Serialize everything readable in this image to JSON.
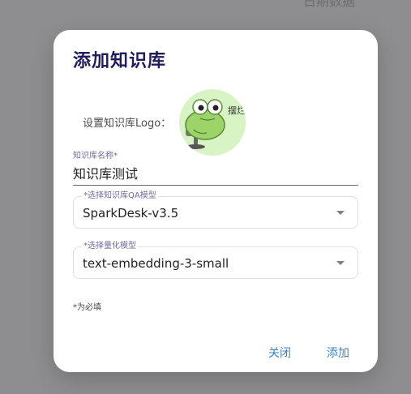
{
  "background": {
    "partial_text": "日期数据"
  },
  "dialog": {
    "title": "添加知识库",
    "logo_label": "设置知识库Logo：",
    "logo_text": "摆烂",
    "name_field": {
      "label": "知识库名称*",
      "value": "知识库测试"
    },
    "qa_model_select": {
      "label": "*选择知识库QA模型",
      "value": "SparkDesk-v3.5"
    },
    "embedding_model_select": {
      "label": "*选择量化模型",
      "value": "text-embedding-3-small"
    },
    "required_note": "*为必填",
    "close_label": "关闭",
    "add_label": "添加"
  },
  "colors": {
    "backdrop": "#8e8e91",
    "title": "#1f1e5a",
    "accent_button": "#3b82c4",
    "logo_background": "#d8f3c4"
  }
}
